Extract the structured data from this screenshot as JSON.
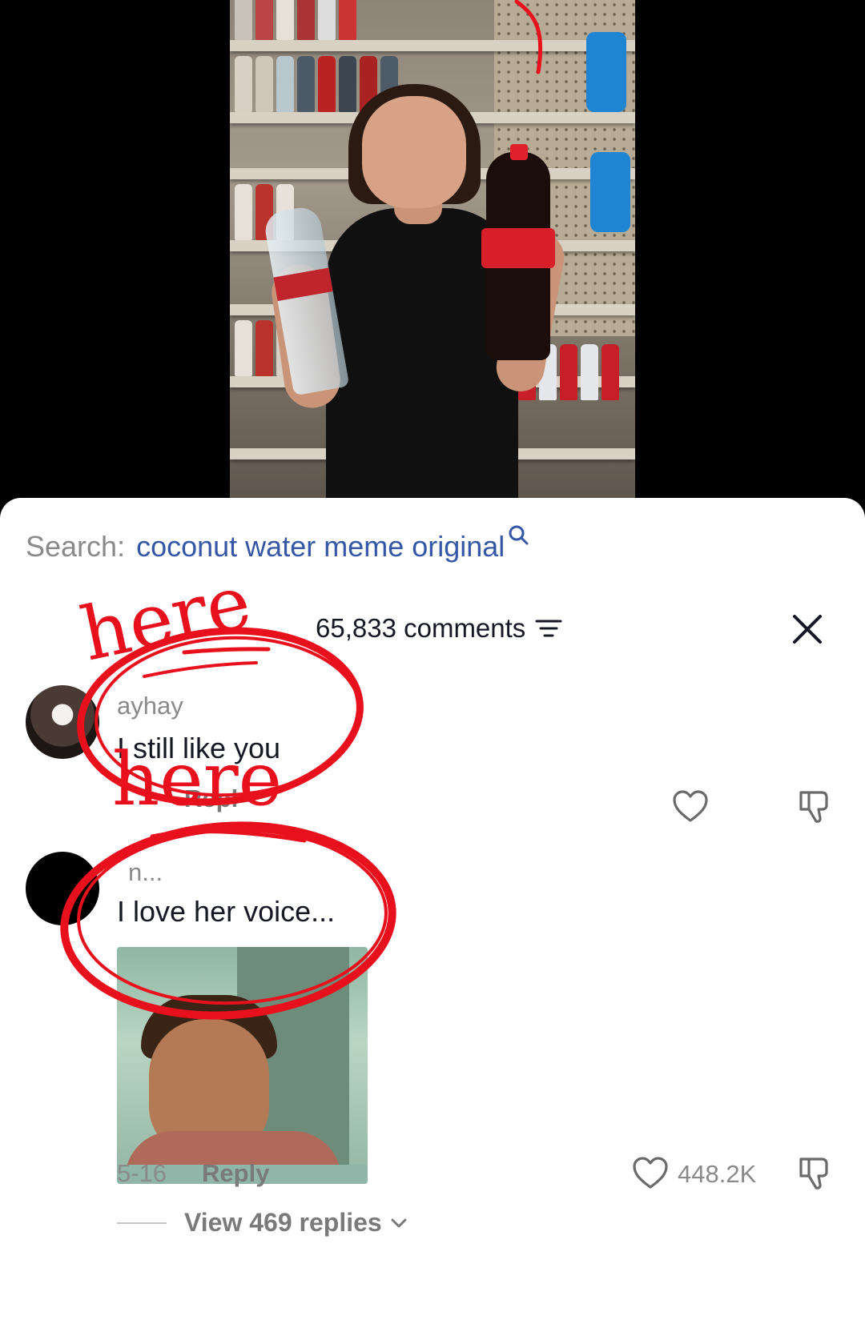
{
  "search": {
    "prefix": "Search:",
    "query": "coconut water meme original",
    "icon": "search-icon"
  },
  "comments_header": {
    "count_label": "65,833 comments",
    "filter_icon": "filter-icon",
    "close_icon": "close-icon"
  },
  "comments": [
    {
      "username": "ayhay",
      "text": "I still like you",
      "reply_label": "Repl"
    },
    {
      "username": "n...",
      "text": "I love her voice...",
      "date": "5-16",
      "reply_label": "Reply",
      "like_count": "448.2K",
      "view_replies_label": "View 469 replies"
    }
  ],
  "annotations": {
    "top_label": "here",
    "mid_label": "here",
    "color": "#e8101c"
  },
  "colors": {
    "query_blue": "#3557a6",
    "muted": "#8a8a8a",
    "text": "#161823"
  }
}
